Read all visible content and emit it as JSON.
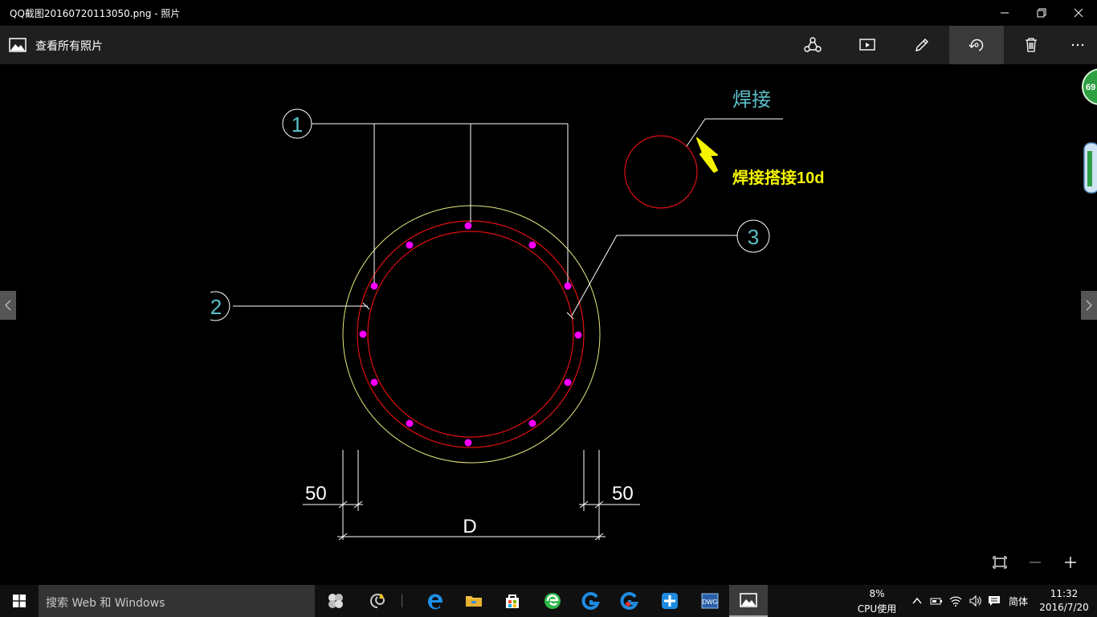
{
  "window": {
    "title": "QQ截图20160720113050.png - 照片"
  },
  "appbar": {
    "back_label": "查看所有照片",
    "tools": [
      "share-icon",
      "slideshow-icon",
      "edit-icon",
      "rotate-icon",
      "delete-icon",
      "more-icon"
    ]
  },
  "drawing": {
    "callout_1": "1",
    "callout_2": "2",
    "callout_3": "3",
    "weld_label": "焊接",
    "weld_note": "焊接搭接10d",
    "dim_left": "50",
    "dim_right": "50",
    "dim_total": "D"
  },
  "side_widget": {
    "badge": "69"
  },
  "taskbar": {
    "search_placeholder": "搜索 Web 和 Windows",
    "cpu_percent": "8%",
    "cpu_label": "CPU使用",
    "ime": "简体",
    "time": "11:32",
    "date": "2016/7/20"
  },
  "colors": {
    "accent_yellow": "#f5f500",
    "ring_red": "#e01010",
    "bar_magenta": "#ff00ff",
    "outline_yellow": "#e8e880",
    "label_cyan": "#5bc0c8"
  }
}
